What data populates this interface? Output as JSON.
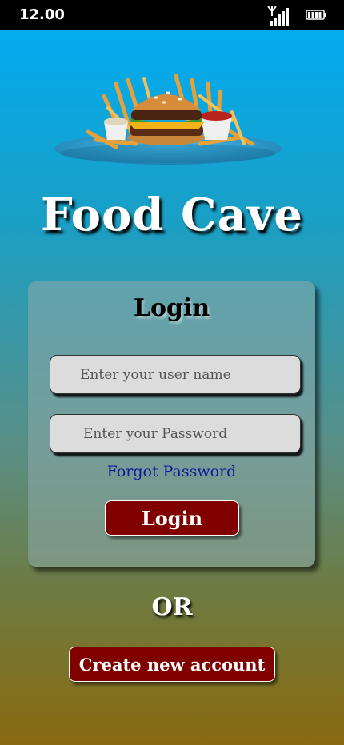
{
  "status_bar": {
    "time": "12.00",
    "icons": [
      "signal-icon",
      "battery-icon"
    ]
  },
  "hero": {
    "icon": "burger-fries-plate-illustration"
  },
  "app": {
    "title": "Food Cave"
  },
  "login": {
    "heading": "Login",
    "username_placeholder": "Enter your user name",
    "password_placeholder": "Enter your Password",
    "forgot_label": "Forgot Password",
    "button_label": "Login"
  },
  "divider": {
    "label": "OR"
  },
  "signup": {
    "button_label": "Create new account"
  },
  "colors": {
    "gradient_top": "#00adf7",
    "gradient_bottom": "#8a6a10",
    "button_bg": "#800000",
    "link": "#0a1a9a",
    "field_bg": "#dcdcdc"
  }
}
